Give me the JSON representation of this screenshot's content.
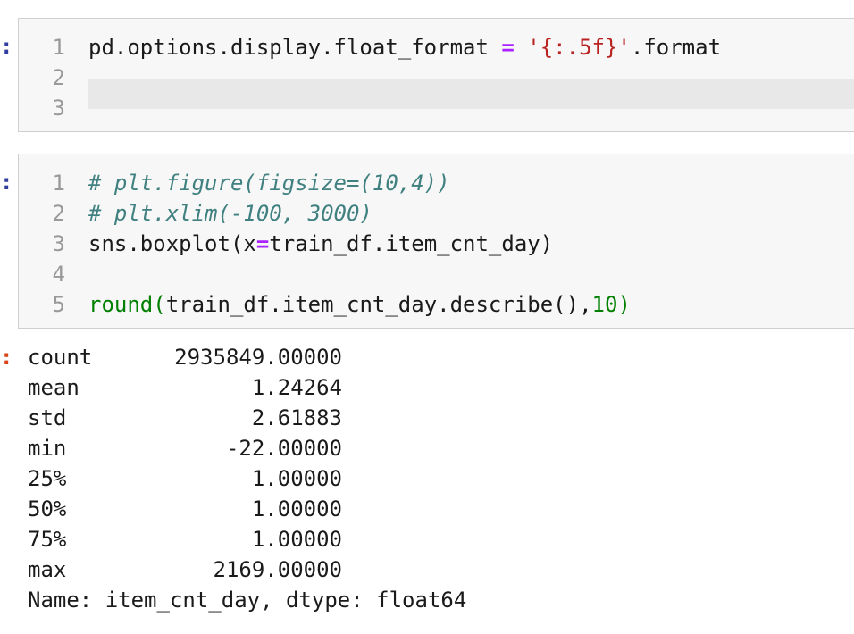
{
  "cells": [
    {
      "lines": [
        "1",
        "2",
        "3"
      ],
      "code_line_1": {
        "pre": "pd.options.display.float_format ",
        "op": "=",
        "sp": " ",
        "str": "'{:.5f}'",
        "post": ".format"
      }
    },
    {
      "lines": [
        "1",
        "2",
        "3",
        "4",
        "5"
      ],
      "comment_1": "# plt.figure(figsize=(10,4))",
      "comment_2": "# plt.xlim(-100, 3000)",
      "line_3": {
        "pre": "sns.boxplot(x",
        "op": "=",
        "post": "train_df.item_cnt_day)"
      },
      "line_5": {
        "fn": "round(",
        "mid": "train_df.item_cnt_day.describe(),",
        "num": "10",
        "close": ")"
      }
    }
  ],
  "output": {
    "rows": [
      {
        "key": "count",
        "value": "2935849.00000"
      },
      {
        "key": "mean",
        "value": "1.24264"
      },
      {
        "key": "std",
        "value": "2.61883"
      },
      {
        "key": "min",
        "value": "-22.00000"
      },
      {
        "key": "25%",
        "value": "1.00000"
      },
      {
        "key": "50%",
        "value": "1.00000"
      },
      {
        "key": "75%",
        "value": "1.00000"
      },
      {
        "key": "max",
        "value": "2169.00000"
      }
    ],
    "footer": "Name: item_cnt_day, dtype: float64"
  },
  "prompts": {
    "in": ":",
    "out": ":"
  }
}
